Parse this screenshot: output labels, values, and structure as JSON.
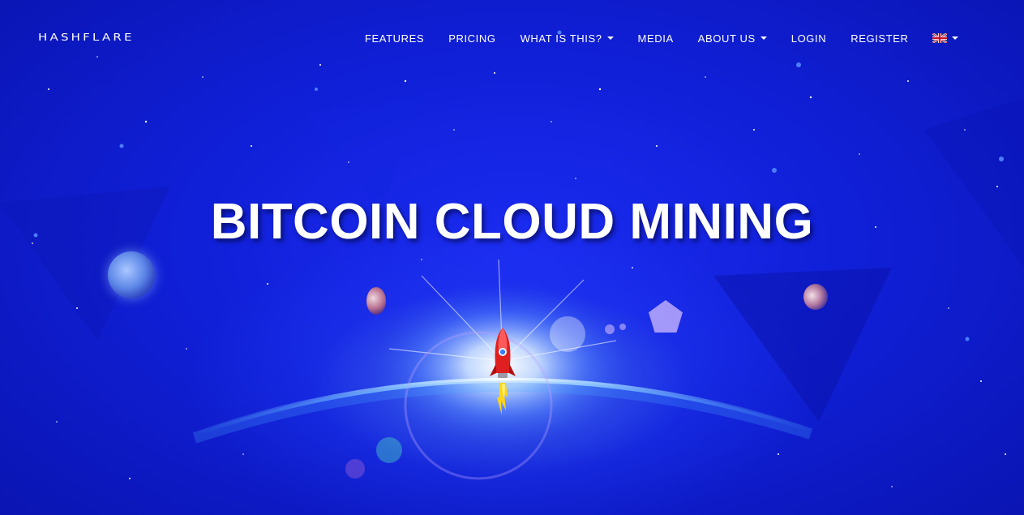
{
  "logo": {
    "text": "HASHFLARE"
  },
  "nav": {
    "items": [
      {
        "label": "FEATURES",
        "dropdown": false
      },
      {
        "label": "PRICING",
        "dropdown": false
      },
      {
        "label": "WHAT IS THIS?",
        "dropdown": true
      },
      {
        "label": "MEDIA",
        "dropdown": false
      },
      {
        "label": "ABOUT US",
        "dropdown": true
      },
      {
        "label": "LOGIN",
        "dropdown": false
      },
      {
        "label": "REGISTER",
        "dropdown": false
      }
    ],
    "language": {
      "icon": "uk-flag-icon",
      "dropdown": true
    }
  },
  "hero": {
    "headline": "BITCOIN CLOUD MINING",
    "icons": [
      "rocket-icon",
      "planet-icon",
      "pentagon-icon"
    ]
  },
  "colors": {
    "background": "#0c16c9",
    "text": "#ffffff",
    "rocket": "#e02020"
  }
}
